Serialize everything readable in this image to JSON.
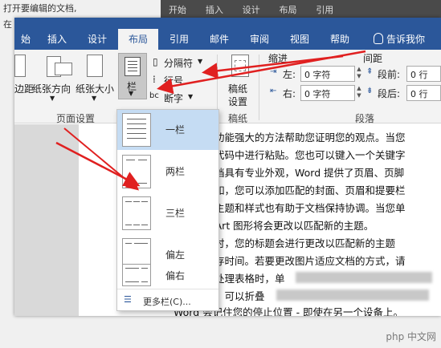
{
  "background": {
    "top_text": "打开要编辑的文档,",
    "side_text": "在",
    "dark_tabs": [
      "开始",
      "插入",
      "设计",
      "布局",
      "引用"
    ]
  },
  "tabs": [
    {
      "label": "始"
    },
    {
      "label": "插入"
    },
    {
      "label": "设计"
    },
    {
      "label": "布局",
      "active": true
    },
    {
      "label": "引用"
    },
    {
      "label": "邮件"
    },
    {
      "label": "审阅"
    },
    {
      "label": "视图"
    },
    {
      "label": "帮助"
    },
    {
      "label": "告诉我你"
    }
  ],
  "ribbon": {
    "margins_label": "边距",
    "orientation_label": "纸张方向",
    "size_label": "纸张大小",
    "columns_label": "栏",
    "breaks_label": "分隔符",
    "line_numbers_label": "行号",
    "hyphenation_label": "断字",
    "manuscript_label_1": "稿纸",
    "manuscript_label_2": "设置",
    "indent_label": "缩进",
    "spacing_label": "间距",
    "left_label": "左:",
    "left_value": "0 字符",
    "right_label": "右:",
    "right_value": "0 字符",
    "before_label": "段前:",
    "before_value": "0 行",
    "after_label": "段后:",
    "after_value": "0 行",
    "group_page_setup": "页面设置",
    "group_manuscript": "稿纸",
    "group_paragraph": "段落"
  },
  "columns_menu": {
    "items": [
      {
        "label": "一栏"
      },
      {
        "label": "两栏"
      },
      {
        "label": "三栏"
      },
      {
        "label": "偏左"
      },
      {
        "label": "偏右"
      }
    ],
    "more": "更多栏(C)..."
  },
  "document": {
    "lines": [
      "供了功能强大的方法帮助您证明您的观点。当您",
      "嵌入代码中进行粘贴。您也可以键入一个关键字",
      "的文档具有专业外观，Word 提供了页眉、页脚",
      "。例如，您可以添加匹配的封面、页眉和提要栏",
      "素。主题和样式也有助于文档保持协调。当您单",
      "nartArt 图形将会更改以匹配新的主题。",
      "样式时，您的标题会进行更改以匹配新的主题",
      "中保存时间。若要更改图片适应文档的方式，请",
      "。当处理表格时，单",
      "容易。可以折叠",
      "Word 会记住您的停止位置 - 即使在另一个设备上。"
    ]
  },
  "watermark": "php 中文网"
}
